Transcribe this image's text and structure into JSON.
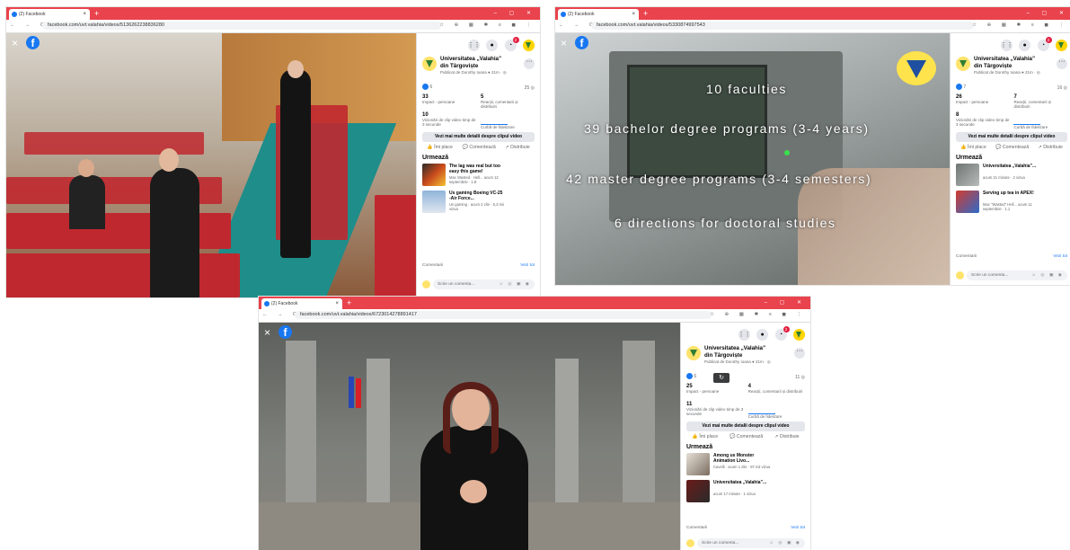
{
  "browser": {
    "tab_title": "(2) Facebook",
    "tab_close": "×",
    "new_tab": "+",
    "window_controls": "– ▢ ✕",
    "nav": "← → C",
    "tools": "☆ ⊕ ▦ ✱ ≡ ◼ ⋮",
    "urls": [
      "facebook.com/uvt.valahia/videos/5136262238836280",
      "facebook.com/uvt.valahia/videos/5330874997543",
      "facebook.com/uvt.valahia/videos/6723014278891417"
    ]
  },
  "fb": {
    "close": "×",
    "logo": "f",
    "grid": "⋮⋮",
    "messenger": "●",
    "bell_badge": "2",
    "page_name": "Universitatea „Valahia” din Târgoviște",
    "page_sub": "Publicat de Dorothy Ioana ● 21m · ◎",
    "more": "···",
    "detail_btn": "Vezi mai multe detalii despre clipul video",
    "like": "Îmi place",
    "comment": "Comentează",
    "share": "Distribuie",
    "up_next": "Urmează",
    "comments_label": "Comentarii",
    "see_all": "Vezi tot",
    "comment_placeholder": "Scrie un comenta...",
    "comment_icons": "☺ ◎ ▣ ◉",
    "impact_label": "Impact - persoane",
    "reactions_label": "Reacții, comentarii și distribuiri",
    "views_label": "Vizionări de clip video timp de 3 secunde",
    "retention_label": "Curbă de fidelizare"
  },
  "shots": [
    {
      "reactions": "6",
      "count_right": "25 ◎",
      "impact": "33",
      "engagement": "5",
      "views": "10",
      "up_next": [
        {
          "title": "The lag was real but too easy this game!",
          "sub": "Mac Wasted · Hell... acum 12 septembrie · 1.8"
        },
        {
          "title": "Us gaming Boeing VC-25 -Air Force...",
          "sub": "Us gaming · acum 2 zile · 5,3 mii vizua"
        }
      ]
    },
    {
      "reactions": "7",
      "count_right": "16 ◎",
      "impact": "26",
      "engagement": "7",
      "views": "8",
      "overlay": [
        "10 faculties",
        "39 bachelor degree programs (3-4 years)",
        "42 master degree programs (3-4 semesters)",
        "6 directions for doctoral studies"
      ],
      "up_next": [
        {
          "title": "Universitatea „Valahia”...",
          "sub": "acum 21 minute · 2 vizua"
        },
        {
          "title": "Serving up tea in APEX!",
          "sub": "Mac \"Wasted\" Hell... acum 11 septembrie · 1.1"
        }
      ]
    },
    {
      "reactions": "6",
      "count_right": "11 ◎",
      "impact": "25",
      "engagement": "4",
      "views": "11",
      "up_next": [
        {
          "title": "Among us Monster Animation Livo...",
          "sub": "Cavelli · acum 1 zile · 87 mii vizua"
        },
        {
          "title": "Universitatea „Valahia”...",
          "sub": "acum 17 minute · 1 vizua"
        }
      ]
    }
  ]
}
